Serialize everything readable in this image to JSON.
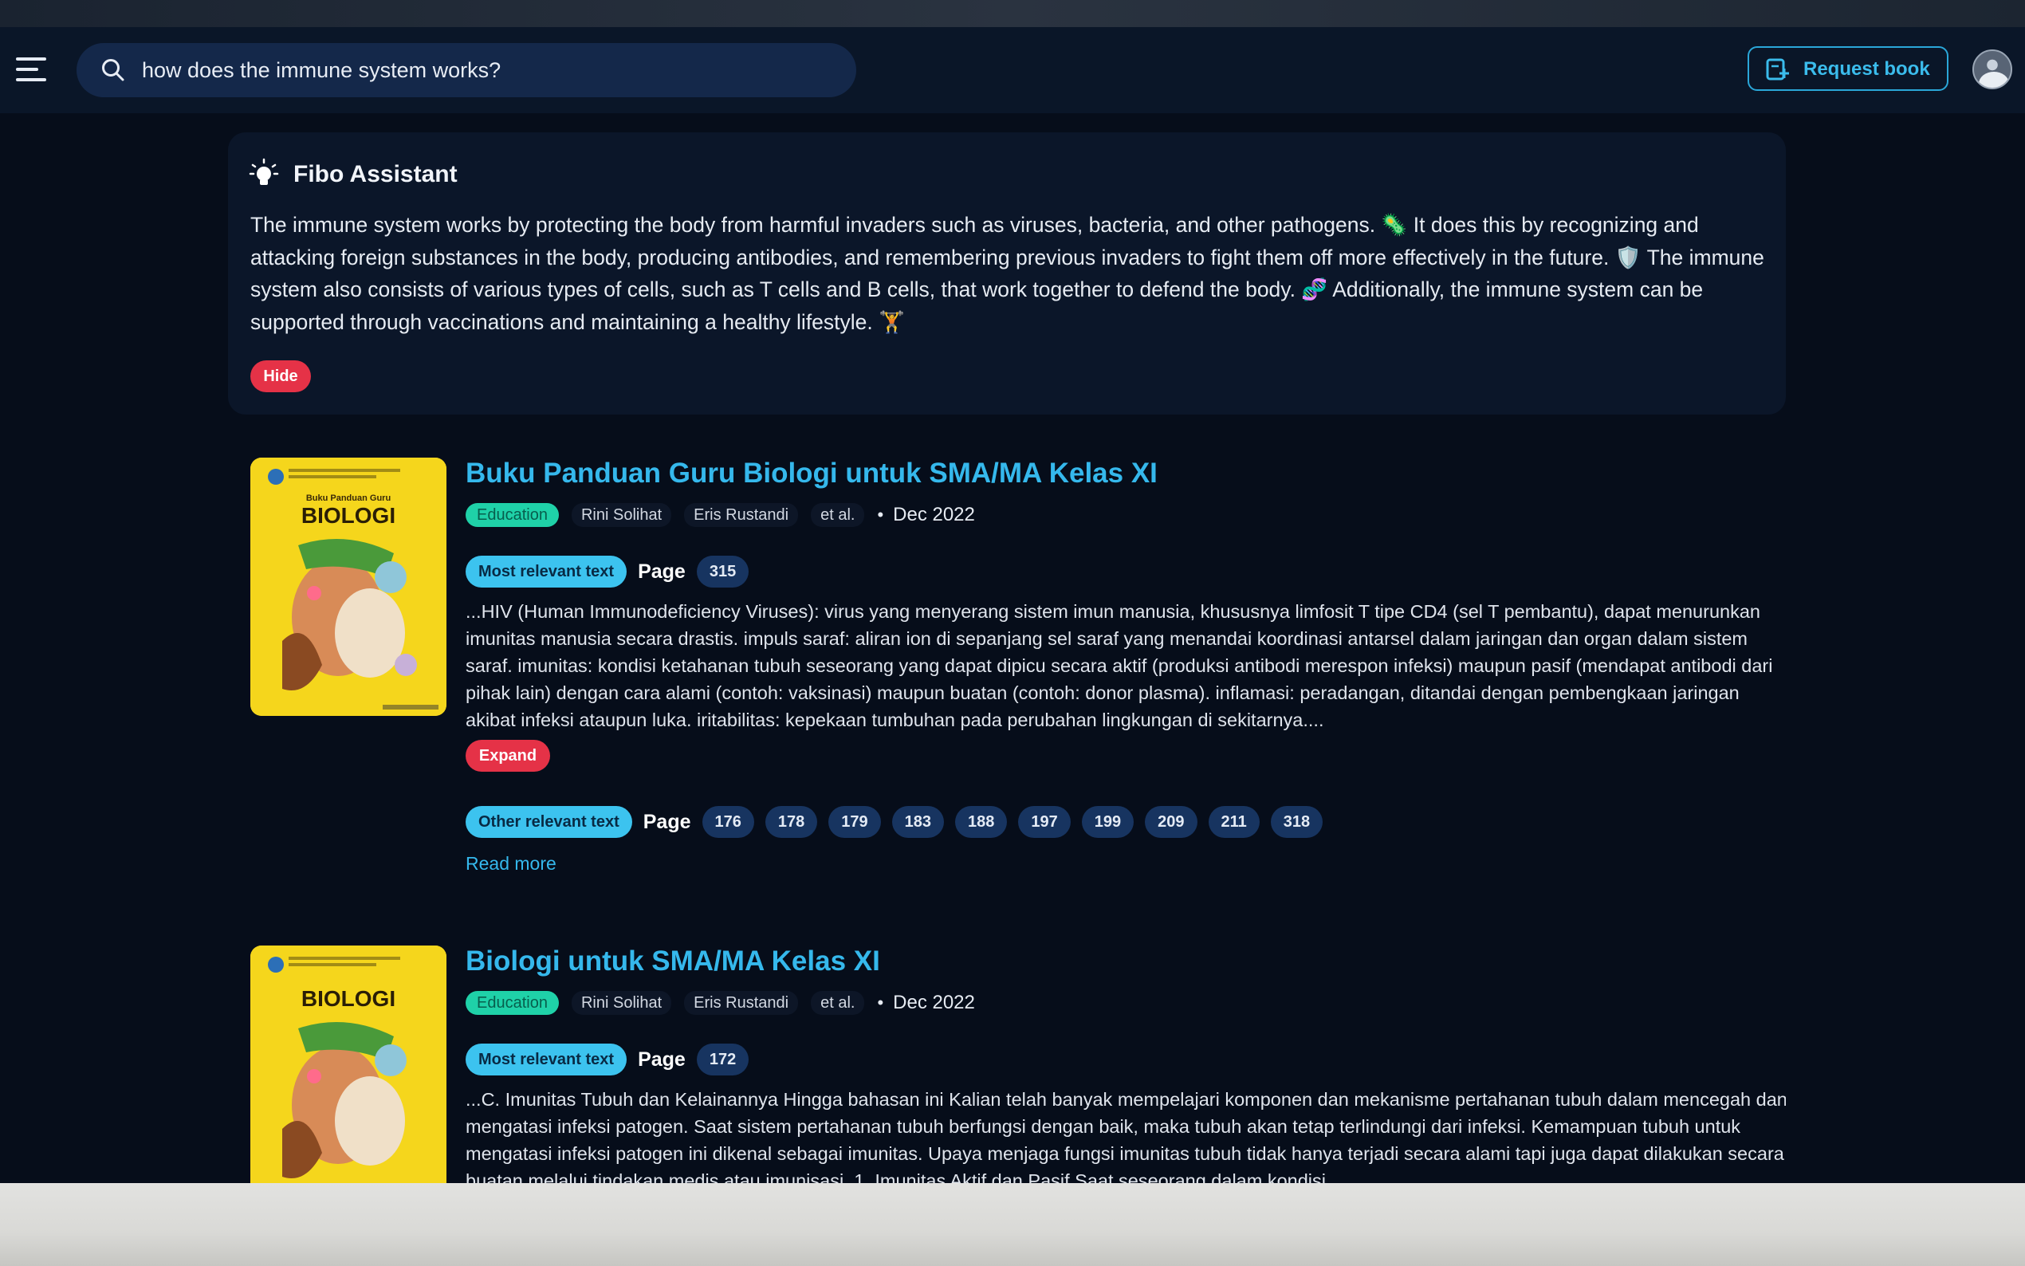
{
  "header": {
    "search_value": "how does the immune system works?",
    "request_book_label": "Request book"
  },
  "assistant": {
    "title": "Fibo Assistant",
    "answer": "The immune system works by protecting the body from harmful invaders such as viruses, bacteria, and other pathogens. 🦠 It does this by recognizing and attacking foreign substances in the body, producing antibodies, and remembering previous invaders to fight them off more effectively in the future. 🛡️ The immune system also consists of various types of cells, such as T cells and B cells, that work together to defend the body. 🧬 Additionally, the immune system can be supported through vaccinations and maintaining a healthy lifestyle. 🏋️",
    "hide_label": "Hide"
  },
  "results": [
    {
      "title": "Buku Panduan Guru Biologi untuk SMA/MA Kelas XI",
      "category": "Education",
      "authors": [
        "Rini Solihat",
        "Eris Rustandi",
        "et al."
      ],
      "date": "Dec 2022",
      "cover_subtitle": "Buku Panduan Guru",
      "cover_title": "BIOLOGI",
      "most_relevant_label": "Most relevant text",
      "page_label": "Page",
      "most_relevant_page": "315",
      "excerpt": "...HIV (Human Immunodeficiency Viruses): virus yang menyerang sistem imun manusia, khususnya limfosit T tipe CD4 (sel T pembantu), dapat menurunkan imunitas manusia secara drastis. impuls saraf: aliran ion di sepanjang sel saraf yang menandai koordinasi antarsel dalam jaringan dan organ dalam sistem saraf. imunitas: kondisi ketahanan tubuh seseorang yang dapat dipicu secara aktif (produksi antibodi merespon infeksi) maupun pasif (mendapat antibodi dari pihak lain) dengan cara alami (contoh: vaksinasi) maupun buatan (contoh: donor plasma). inflamasi: peradangan, ditandai dengan pembengkaan jaringan akibat infeksi ataupun luka. iritabilitas: kepekaan tumbuhan pada perubahan lingkungan di sekitarnya....",
      "expand_label": "Expand",
      "other_relevant_label": "Other relevant text",
      "other_pages": [
        "176",
        "178",
        "179",
        "183",
        "188",
        "197",
        "199",
        "209",
        "211",
        "318"
      ],
      "read_more_label": "Read more"
    },
    {
      "title": "Biologi untuk SMA/MA Kelas XI",
      "category": "Education",
      "authors": [
        "Rini Solihat",
        "Eris Rustandi",
        "et al."
      ],
      "date": "Dec 2022",
      "cover_title": "BIOLOGI",
      "most_relevant_label": "Most relevant text",
      "page_label": "Page",
      "most_relevant_page": "172",
      "excerpt": "...C. Imunitas Tubuh dan Kelainannya Hingga bahasan ini Kalian telah banyak mempelajari komponen dan mekanisme pertahanan tubuh dalam mencegah dan mengatasi infeksi patogen. Saat sistem pertahanan tubuh berfungsi dengan baik, maka tubuh akan tetap terlindungi dari infeksi. Kemampuan tubuh untuk mengatasi infeksi patogen ini dikenal sebagai imunitas. Upaya menjaga fungsi imunitas tubuh tidak hanya terjadi secara alami tapi juga dapat dilakukan secara buatan melalui tindakan medis atau imunisasi. 1. Imunitas Aktif dan Pasif Saat seseorang dalam kondisi"
    }
  ],
  "colors": {
    "background": "#060d1a",
    "accent": "#35b8ec",
    "danger": "#e53247",
    "education_tag": "#1fd1a8"
  },
  "icons": {
    "menu": "hamburger-icon",
    "search": "search-icon",
    "request": "book-request-icon",
    "assistant": "lightbulb-icon"
  }
}
